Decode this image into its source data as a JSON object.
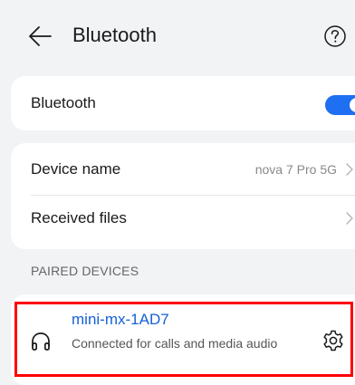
{
  "header": {
    "title": "Bluetooth",
    "back_icon": "arrow-left-icon",
    "help_icon": "question-circle-icon"
  },
  "bluetooth_toggle": {
    "label": "Bluetooth",
    "enabled": true,
    "accent_color": "#1e6ff2"
  },
  "device_settings": {
    "device_name_label": "Device name",
    "device_name_value": "nova 7 Pro 5G",
    "received_files_label": "Received files"
  },
  "paired_devices": {
    "section_title": "PAIRED DEVICES",
    "devices": [
      {
        "name": "mini-mx-1AD7",
        "status": "Connected for calls and media audio",
        "icon": "headphones-icon",
        "settings_icon": "gear-icon"
      }
    ]
  },
  "colors": {
    "background": "#f1f3f5",
    "card": "#ffffff",
    "link_blue": "#1561d8",
    "highlight": "#ff0000"
  }
}
